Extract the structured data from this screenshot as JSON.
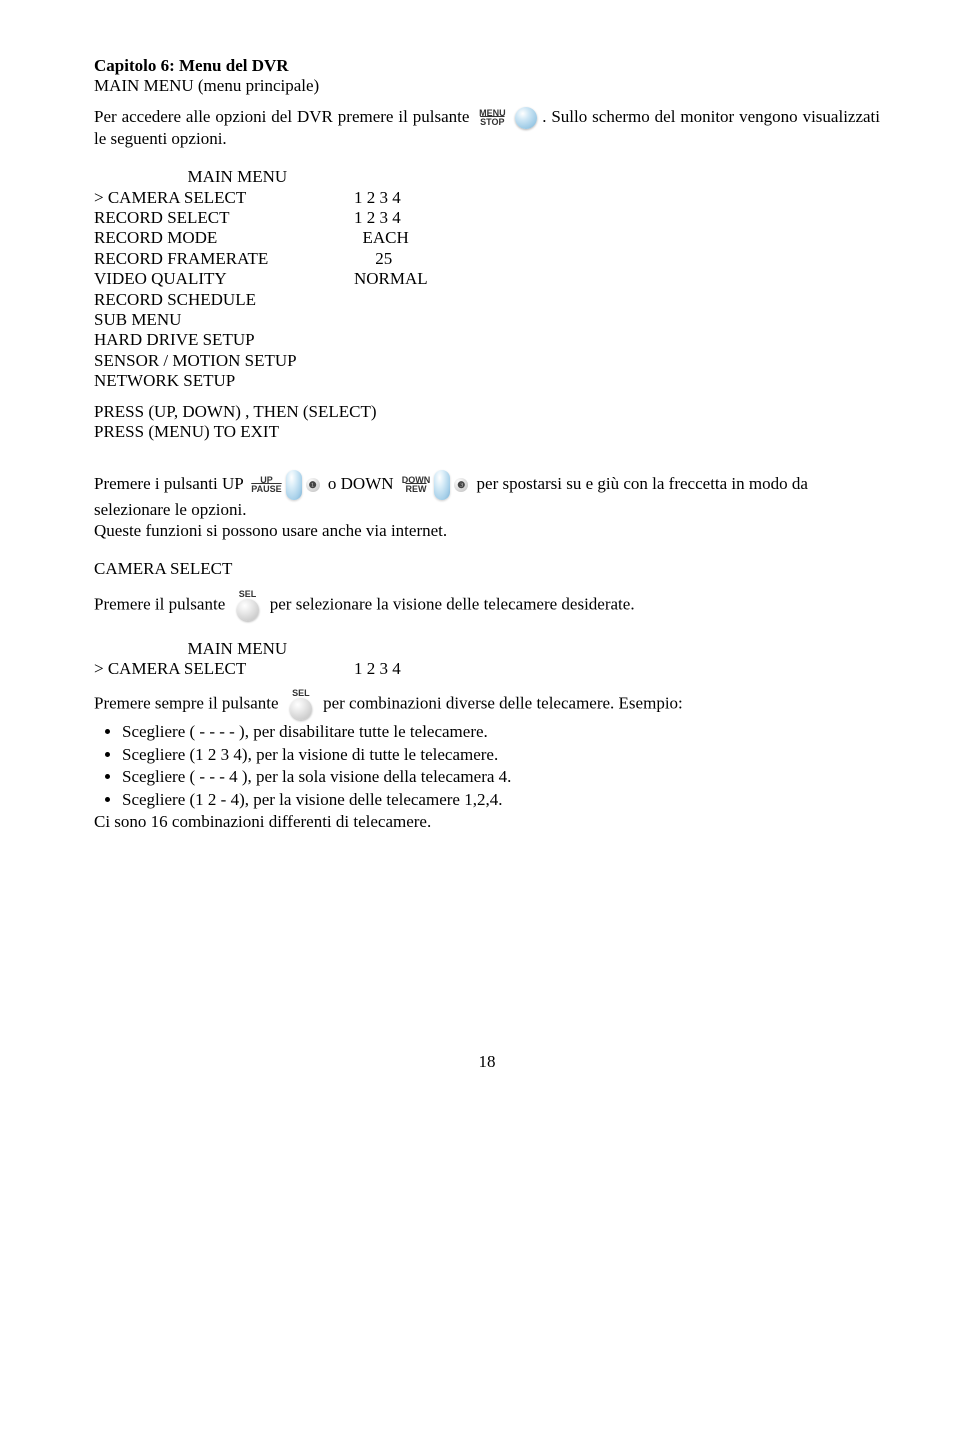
{
  "title": "Capitolo 6: Menu del DVR",
  "subtitle": "MAIN MENU (menu principale)",
  "intro_before": "Per accedere alle opzioni del DVR premere il pulsante ",
  "intro_after": ". Sullo schermo del monitor vengono visualizzati le seguenti opzioni.",
  "menu_stop": {
    "top": "MENU",
    "bottom": "STOP"
  },
  "menu": {
    "header_indent": "                      MAIN MENU",
    "rows": [
      {
        "label": "> CAMERA SELECT",
        "val": "1 2 3 4"
      },
      {
        "label": "RECORD SELECT",
        "val": "1 2 3 4"
      },
      {
        "label": "RECORD MODE",
        "val": "  EACH"
      },
      {
        "label": "RECORD FRAMERATE",
        "val": "     25"
      },
      {
        "label": "VIDEO QUALITY",
        "val": "NORMAL"
      },
      {
        "label": "RECORD SCHEDULE",
        "val": ""
      },
      {
        "label": "SUB MENU",
        "val": ""
      },
      {
        "label": "HARD DRIVE SETUP",
        "val": ""
      },
      {
        "label": "SENSOR / MOTION SETUP",
        "val": ""
      },
      {
        "label": "NETWORK SETUP",
        "val": ""
      }
    ],
    "press1": "PRESS (UP, DOWN) , THEN (SELECT)",
    "press2": "PRESS (MENU) TO EXIT"
  },
  "nav_buttons": {
    "up_top": "UP",
    "up_bottom": "PAUSE",
    "up_dot": "❶",
    "down_top": "DOWN",
    "down_bottom": "REW",
    "down_dot": "❸"
  },
  "nav_sentence": {
    "a": "Premere i pulsanti UP ",
    "b": " o DOWN ",
    "c": " per spostarsi su e giù con la freccetta in modo da selezionare le opzioni.",
    "d": "Queste funzioni si possono usare anche via internet."
  },
  "camera_select": {
    "heading": "CAMERA SELECT",
    "line_before": "Premere il pulsante ",
    "line_after": " per selezionare la visione delle telecamere desiderate.",
    "sel_label": "SEL",
    "menu_header": "                      MAIN MENU",
    "menu_row_label": "> CAMERA SELECT",
    "menu_row_val": "1 2 3 4",
    "sempre_before": "Premere sempre il pulsante ",
    "sempre_after": " per combinazioni diverse delle telecamere. Esempio:",
    "bullets": [
      "Scegliere ( - - - - ), per disabilitare tutte le telecamere.",
      "Scegliere (1 2 3 4), per la visione di tutte le telecamere.",
      "Scegliere ( - - - 4 ), per la sola visione della telecamera 4.",
      "Scegliere (1 2 - 4), per la visione delle telecamere 1,2,4."
    ],
    "footer": "Ci sono 16 combinazioni differenti di telecamere."
  },
  "page_number": "18"
}
